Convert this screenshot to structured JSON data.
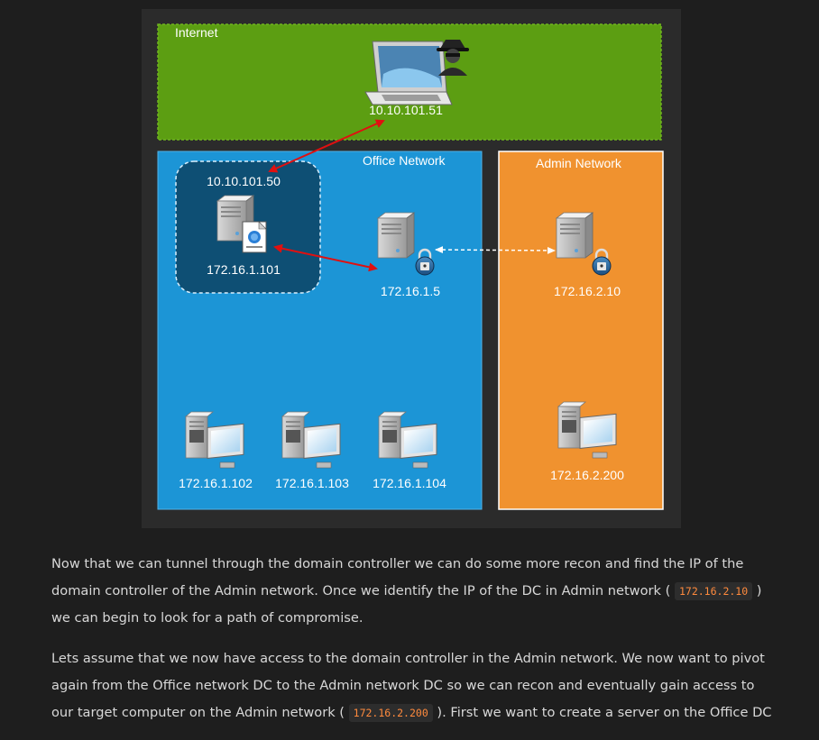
{
  "diagram": {
    "internet": {
      "label": "Internet",
      "attacker_ip": "10.10.101.51"
    },
    "office": {
      "label": "Office Network",
      "pivot_host": {
        "external_ip": "10.10.101.50",
        "internal_ip": "172.16.1.101"
      },
      "dc_ip": "172.16.1.5",
      "workstations": [
        "172.16.1.102",
        "172.16.1.103",
        "172.16.1.104"
      ]
    },
    "admin": {
      "label": "Admin Network",
      "dc_ip": "172.16.2.10",
      "target_ip": "172.16.2.200"
    }
  },
  "article": {
    "p1": {
      "before": "Now that we can tunnel through the domain controller we can do some more recon and find the IP of the domain controller of the Admin network. Once we identify the IP of the DC in Admin network (",
      "code": "172.16.2.10",
      "after": ") we can begin to look for a path of compromise."
    },
    "p2": {
      "before": "Lets assume that we now have access to the domain controller in the Admin network. We now want to pivot again from the Office network DC to the Admin network DC so we can recon and eventually gain access to our target computer on the Admin network (",
      "code": "172.16.2.200",
      "after": "). First we want to create a server on the Office DC"
    }
  }
}
